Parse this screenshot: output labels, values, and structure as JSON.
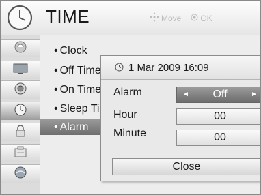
{
  "header": {
    "title": "TIME",
    "hint_move": "Move",
    "hint_ok": "OK",
    "icon": "clock-icon"
  },
  "sidebar": {
    "items": [
      {
        "icon": "picture-icon"
      },
      {
        "icon": "screen-icon"
      },
      {
        "icon": "audio-icon"
      },
      {
        "icon": "time-icon",
        "active": true
      },
      {
        "icon": "lock-icon"
      },
      {
        "icon": "option-icon"
      },
      {
        "icon": "network-icon"
      }
    ]
  },
  "menu": {
    "items": [
      {
        "label": "Clock"
      },
      {
        "label": "Off Time"
      },
      {
        "label": "On Time"
      },
      {
        "label": "Sleep Timer"
      },
      {
        "label": "Alarm",
        "selected": true
      }
    ]
  },
  "popup": {
    "datetime": "1 Mar 2009 16:09",
    "alarm_label": "Alarm",
    "alarm_value": "Off",
    "hour_label": "Hour",
    "hour_value": "00",
    "minute_label": "Minute",
    "minute_value": "00",
    "close_label": "Close"
  },
  "colors": {
    "selected_bg": "#7e7e7e",
    "hint_text": "#bcbcbc"
  }
}
